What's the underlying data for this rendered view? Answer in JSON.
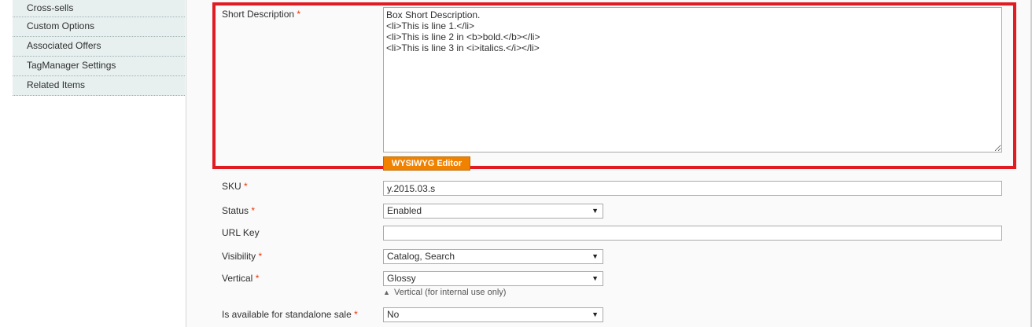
{
  "sidebar": {
    "items": [
      {
        "label": "Cross-sells"
      },
      {
        "label": "Custom Options"
      },
      {
        "label": "Associated Offers"
      },
      {
        "label": "TagManager Settings"
      },
      {
        "label": "Related Items"
      }
    ]
  },
  "short_description": {
    "label": "Short Description",
    "required_mark": "*",
    "value": "Box Short Description.\n<li>This is line 1.</li>\n<li>This is line 2 in <b>bold.</b></li>\n<li>This is line 3 in <i>italics.</i></li>",
    "wysiwyg_button_label": "WYSIWYG Editor"
  },
  "sku": {
    "label": "SKU",
    "required_mark": "*",
    "value": "y.2015.03.s"
  },
  "status": {
    "label": "Status",
    "required_mark": "*",
    "value": "Enabled"
  },
  "url_key": {
    "label": "URL Key",
    "value": ""
  },
  "visibility": {
    "label": "Visibility",
    "required_mark": "*",
    "value": "Catalog, Search"
  },
  "vertical": {
    "label": "Vertical",
    "required_mark": "*",
    "value": "Glossy",
    "note": "Vertical (for internal use only)"
  },
  "standalone_sale": {
    "label": "Is available for standalone sale",
    "required_mark": "*",
    "value": "No"
  },
  "icons": {
    "dropdown": "chevron-down-icon",
    "note": "triangle-up-icon"
  },
  "colors": {
    "highlight": "#e11b22",
    "required": "#eb340a",
    "wysiwyg_button": "#f18200",
    "sidebar_bg": "#e7efef"
  }
}
